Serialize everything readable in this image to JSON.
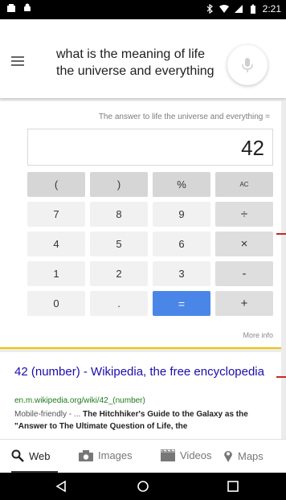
{
  "status_bar": {
    "time": "2:21",
    "icons": [
      "photo-notification-icon",
      "android-notification-icon",
      "bluetooth-icon",
      "wifi-icon",
      "signal-icon",
      "battery-icon"
    ]
  },
  "search": {
    "menu_icon": "hamburger-menu-icon",
    "query": "what is the meaning of life the universe and everything",
    "mic_icon": "microphone-icon"
  },
  "calculator": {
    "expression": "The answer to life the universe and everything =",
    "result": "42",
    "keys": {
      "open_paren": "(",
      "close_paren": ")",
      "percent": "%",
      "clear": "AC",
      "seven": "7",
      "eight": "8",
      "nine": "9",
      "divide": "÷",
      "four": "4",
      "five": "5",
      "six": "6",
      "multiply": "×",
      "one": "1",
      "two": "2",
      "three": "3",
      "minus": "-",
      "zero": "0",
      "dot": ".",
      "equals": "=",
      "plus": "+"
    },
    "more_info": "More info"
  },
  "result": {
    "title": "42 (number) - Wikipedia, the free encyclopedia",
    "url": "en.m.wikipedia.org/wiki/42_(number)",
    "snippet_prefix": "Mobile-friendly - ... ",
    "snippet_bold": "The Hitchhiker's Guide to the Galaxy as the \"Answer to The Ultimate Question of Life, the"
  },
  "tabs": [
    {
      "label": "Web",
      "icon": "search-icon",
      "active": true
    },
    {
      "label": "Images",
      "icon": "camera-icon",
      "active": false
    },
    {
      "label": "Videos",
      "icon": "film-icon",
      "active": false
    },
    {
      "label": "Maps",
      "icon": "map-pin-icon",
      "active": false
    }
  ],
  "nav": [
    "back-icon",
    "home-icon",
    "recents-icon"
  ],
  "colors": {
    "link": "#1a0dab",
    "url_green": "#1e7a1e",
    "equals_blue": "#4a86e8",
    "card_accent": "#f0c200"
  }
}
